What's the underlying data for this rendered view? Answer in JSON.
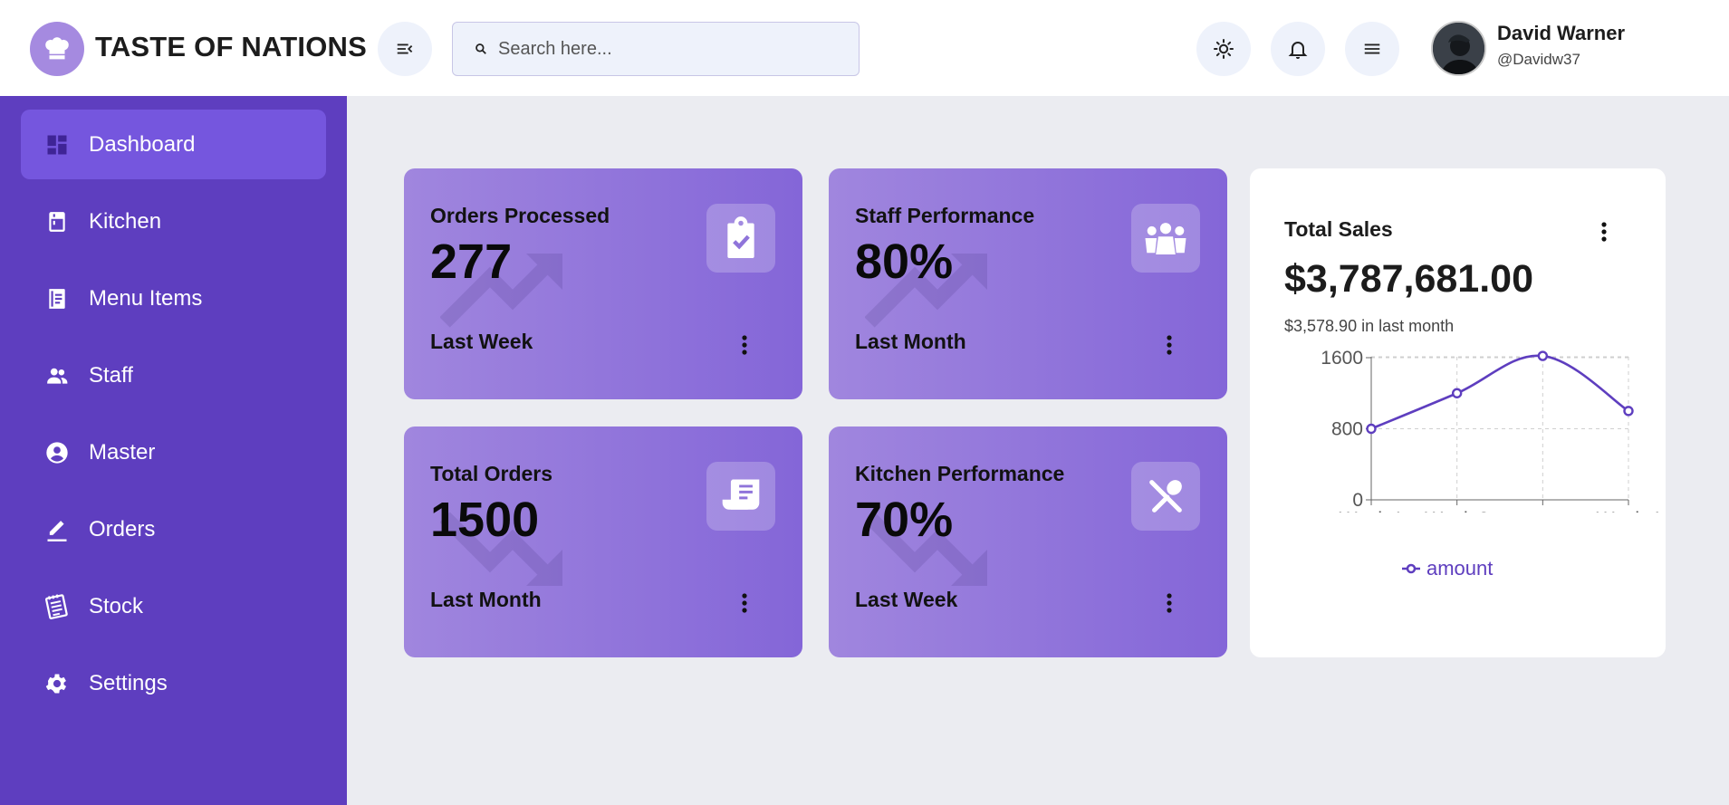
{
  "app": {
    "title": "TASTE OF NATIONS"
  },
  "search": {
    "placeholder": "Search here..."
  },
  "user": {
    "name": "David Warner",
    "handle": "@Davidw37"
  },
  "sidebar": {
    "items": [
      {
        "label": "Dashboard",
        "icon": "dashboard-icon",
        "active": true
      },
      {
        "label": "Kitchen",
        "icon": "kitchen-icon"
      },
      {
        "label": "Menu Items",
        "icon": "menu-book-icon"
      },
      {
        "label": "Staff",
        "icon": "people-icon"
      },
      {
        "label": "Master",
        "icon": "account-circle-icon"
      },
      {
        "label": "Orders",
        "icon": "edit-icon"
      },
      {
        "label": "Stock",
        "icon": "notepad-icon"
      },
      {
        "label": "Settings",
        "icon": "gear-icon"
      }
    ]
  },
  "cards": [
    {
      "title": "Orders Processed",
      "value": "277",
      "period": "Last Week",
      "icon": "clipboard-check-icon",
      "trend": "up"
    },
    {
      "title": "Staff Performance",
      "value": "80%",
      "period": "Last Month",
      "icon": "group-icon",
      "trend": "up"
    },
    {
      "title": "Total Orders",
      "value": "1500",
      "period": "Last Month",
      "icon": "receipt-icon",
      "trend": "down"
    },
    {
      "title": "Kitchen Performance",
      "value": "70%",
      "period": "Last Week",
      "icon": "utensils-icon",
      "trend": "down"
    }
  ],
  "sales": {
    "title": "Total Sales",
    "total": "$3,787,681.00",
    "subtitle": "$3,578.90 in last month"
  },
  "colors": {
    "primary": "#5e3ebf",
    "accent": "#7556de",
    "card_start": "#a086de",
    "card_end": "#8466d8",
    "line": "#5e3ebf"
  },
  "chart_data": {
    "type": "line",
    "x": [
      "Week 1",
      "Week 2",
      "Week 3",
      "Week 4"
    ],
    "x_tick_labels": [
      "Week 1",
      "Week 2",
      "Week 4"
    ],
    "series": [
      {
        "name": "amount",
        "values": [
          800,
          1200,
          1620,
          1000
        ]
      }
    ],
    "ylim": [
      0,
      1600
    ],
    "y_ticks": [
      0,
      800,
      1600
    ],
    "grid": true,
    "legend": "bottom"
  }
}
